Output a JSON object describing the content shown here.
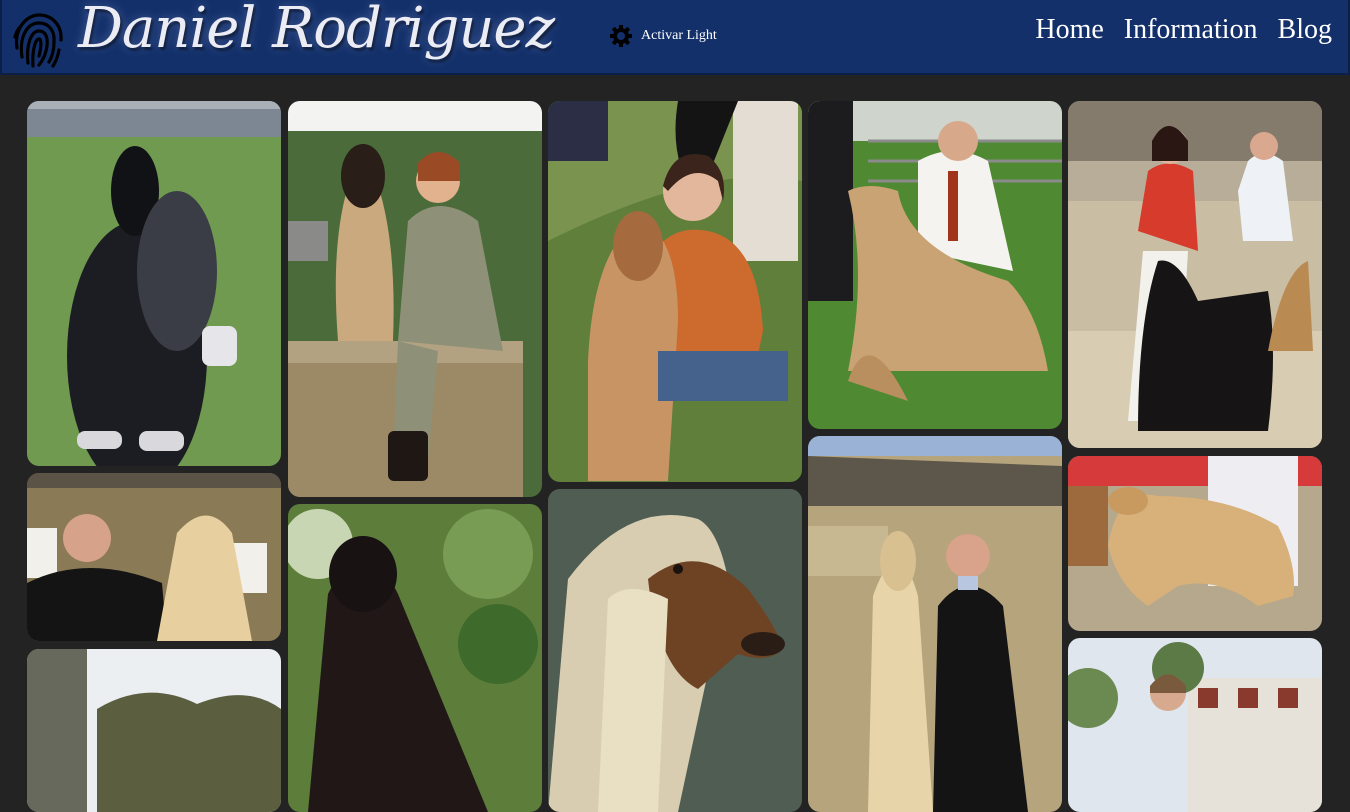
{
  "header": {
    "site_title": "Daniel Rodriguez",
    "logo_icon": "fingerprint-icon",
    "theme_toggle": {
      "icon": "gear-icon",
      "label": "Activar Light"
    },
    "nav": [
      {
        "label": "Home"
      },
      {
        "label": "Information"
      },
      {
        "label": "Blog"
      }
    ]
  },
  "colors": {
    "header_bg": "#13306a",
    "page_bg": "#232323",
    "nav_text": "#ffffff"
  },
  "gallery": {
    "photos": [
      {
        "subject": "black afghan hound on lawn"
      },
      {
        "subject": "man with blonde afghan hound by cottage"
      },
      {
        "subject": "photo near tree line"
      },
      {
        "subject": "woman in suit with afghan hound on stone wall"
      },
      {
        "subject": "black afghan hound in garden"
      },
      {
        "subject": "woman hugging golden afghan hound"
      },
      {
        "subject": "afghan hound head close-up"
      },
      {
        "subject": "man stacking golden afghan hound at show"
      },
      {
        "subject": "man with cream afghan hound by stone cottage"
      },
      {
        "subject": "woman in red jacket with black afghan hound"
      },
      {
        "subject": "golden afghan hound in show ring"
      },
      {
        "subject": "woman outdoors near buildings"
      }
    ]
  }
}
